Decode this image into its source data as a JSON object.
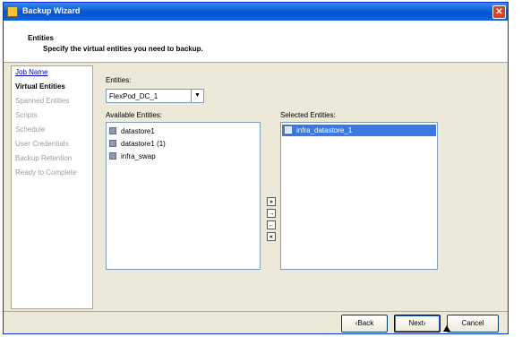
{
  "window": {
    "title": "Backup Wizard"
  },
  "header": {
    "title": "Entities",
    "subtitle": "Specify the virtual entities you need to backup."
  },
  "nav": {
    "items": [
      {
        "label": "Job Name",
        "state": "link"
      },
      {
        "label": "Virtual Entities",
        "state": "current"
      },
      {
        "label": "Spanned Entities",
        "state": "disabled"
      },
      {
        "label": "Scripts",
        "state": "disabled"
      },
      {
        "label": "Schedule",
        "state": "disabled"
      },
      {
        "label": "User Credentials",
        "state": "disabled"
      },
      {
        "label": "Backup Retention",
        "state": "disabled"
      },
      {
        "label": "Ready to Complete",
        "state": "disabled"
      }
    ]
  },
  "entities": {
    "label": "Entities:",
    "selected": "FlexPod_DC_1",
    "available_label": "Available Entities:",
    "available": [
      "datastore1",
      "datastore1 (1)",
      "infra_swap"
    ],
    "selected_label": "Selected Entities:",
    "selected_items": [
      "infra_datastore_1"
    ]
  },
  "buttons": {
    "back": "‹Back",
    "next": "Next›",
    "cancel": "Cancel"
  },
  "icons": {
    "move_all_right": "double-right-arrow-icon",
    "move_right": "right-arrow-icon",
    "move_left": "left-arrow-icon",
    "move_all_left": "double-left-arrow-icon"
  }
}
